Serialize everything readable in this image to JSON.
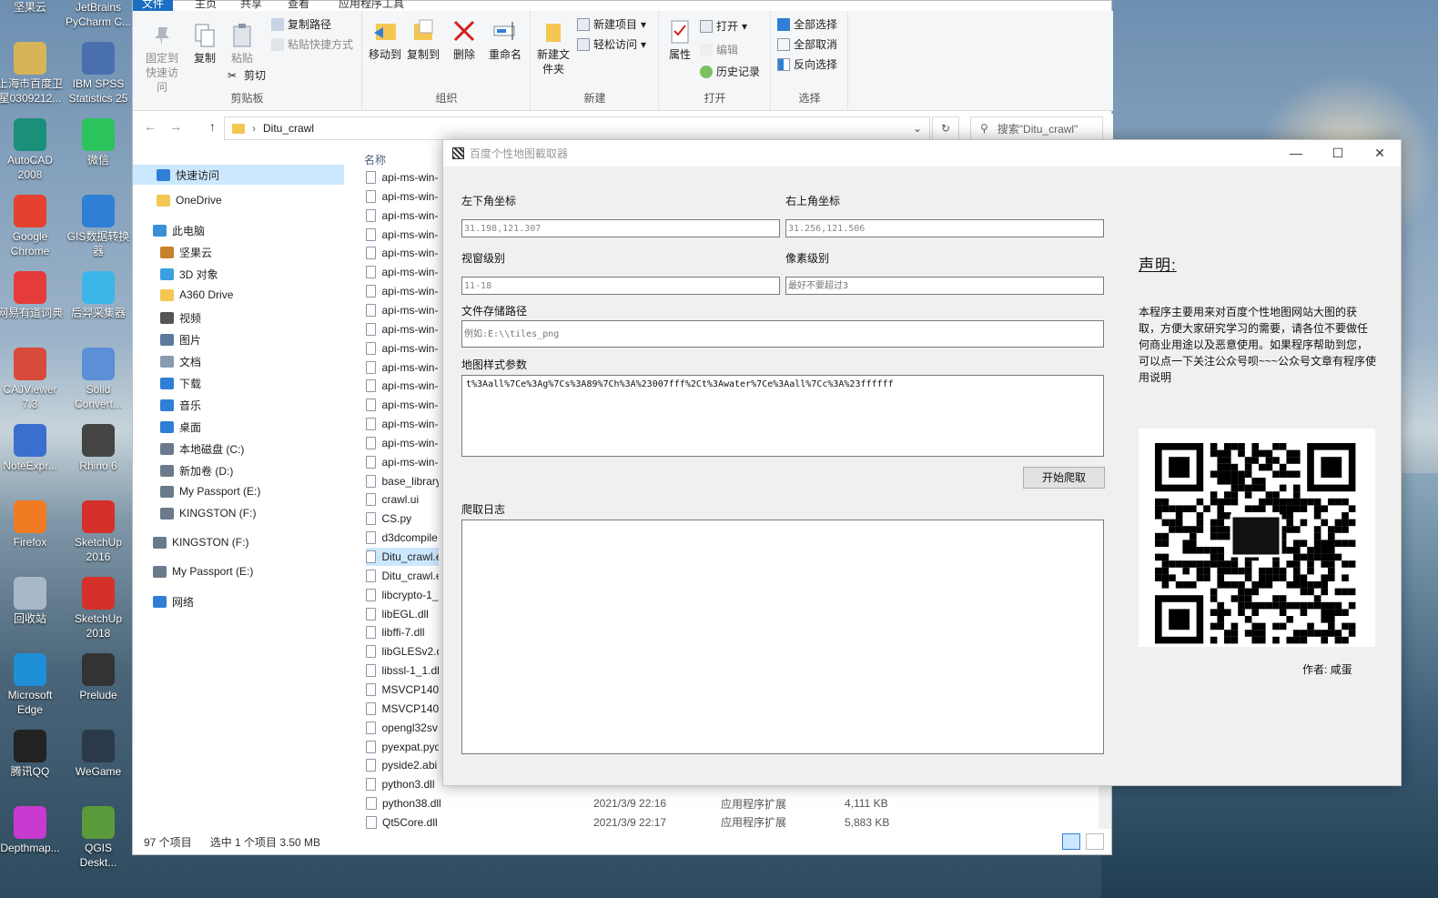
{
  "desktop": {
    "icons": [
      {
        "label": "坚果云",
        "icon": "jianguoyun-icon",
        "color": "#2f8fe0"
      },
      {
        "label": "JetBrains PyCharm C...",
        "icon": "pycharm-icon",
        "color": "#21d789"
      },
      {
        "label": "上海市百度卫星0309212...",
        "icon": "zip-icon",
        "color": "#d8b458"
      },
      {
        "label": "IBM SPSS Statistics 25",
        "icon": "spss-icon",
        "color": "#4a6fb0"
      },
      {
        "label": "AutoCAD 2008",
        "icon": "autocad-icon",
        "color": "#1a8f7a"
      },
      {
        "label": "微信",
        "icon": "wechat-icon",
        "color": "#2bc35c"
      },
      {
        "label": "Google Chrome",
        "icon": "chrome-icon",
        "color": "#e6412f"
      },
      {
        "label": "GIS数据转换器",
        "icon": "gis-icon",
        "color": "#2f7fd6"
      },
      {
        "label": "网易有道词典",
        "icon": "youdao-icon",
        "color": "#e53b3b"
      },
      {
        "label": "后羿采集器",
        "icon": "houyi-icon",
        "color": "#3cb6e8"
      },
      {
        "label": "CAJViewer 7.3",
        "icon": "cajviewer-icon",
        "color": "#d84a3a"
      },
      {
        "label": "Solid Convert...",
        "icon": "solid-icon",
        "color": "#5b8fd6"
      },
      {
        "label": "NoteExpr...",
        "icon": "noteexpress-icon",
        "color": "#3a6fd0"
      },
      {
        "label": "Rhino 6",
        "icon": "rhino-icon",
        "color": "#444444"
      },
      {
        "label": "Firefox",
        "icon": "firefox-icon",
        "color": "#f07b22"
      },
      {
        "label": "SketchUp 2016",
        "icon": "sketchup-icon",
        "color": "#d6302b"
      },
      {
        "label": "回收站",
        "icon": "recycle-bin-icon",
        "color": "#a9b8c8"
      },
      {
        "label": "SketchUp 2018",
        "icon": "sketchup-icon",
        "color": "#d6302b"
      },
      {
        "label": "Microsoft Edge",
        "icon": "edge-icon",
        "color": "#1f8fd8"
      },
      {
        "label": "Prelude",
        "icon": "prelude-icon",
        "color": "#333333"
      },
      {
        "label": "腾讯QQ",
        "icon": "qq-icon",
        "color": "#222222"
      },
      {
        "label": "WeGame",
        "icon": "wegame-icon",
        "color": "#2a3a4a"
      },
      {
        "label": "Depthmap...",
        "icon": "depthmap-icon",
        "color": "#c83ad0"
      },
      {
        "label": "QGIS Deskt...",
        "icon": "qgis-icon",
        "color": "#5a9a3a"
      }
    ]
  },
  "explorer": {
    "ribbon_tabs": [
      "文件",
      "主页",
      "共享",
      "查看",
      "应用程序工具"
    ],
    "clipboard": {
      "pin": "固定到快速访问",
      "copy": "复制",
      "paste": "粘贴",
      "copy_path": "复制路径",
      "paste_shortcut": "粘贴快捷方式",
      "cut": "剪切",
      "label": "剪贴板"
    },
    "organize": {
      "move_to": "移动到",
      "copy_to": "复制到",
      "delete": "删除",
      "rename": "重命名",
      "label": "组织"
    },
    "new": {
      "new_folder": "新建文件夹",
      "new_item": "新建项目",
      "easy_access": "轻松访问",
      "label": "新建"
    },
    "open": {
      "properties": "属性",
      "open": "打开",
      "edit": "编辑",
      "history": "历史记录",
      "label": "打开"
    },
    "select": {
      "select_all": "全部选择",
      "select_none": "全部取消",
      "invert": "反向选择",
      "label": "选择"
    },
    "address": {
      "path": "Ditu_crawl",
      "search_placeholder": "搜索\"Ditu_crawl\""
    },
    "nav": [
      {
        "label": "快速访问",
        "icon": "star-icon",
        "color": "#2f7fd6"
      },
      {
        "label": "OneDrive",
        "icon": "onedrive-icon",
        "color": "#f4c752"
      },
      {
        "label": "此电脑",
        "icon": "pc-icon",
        "color": "#3a8fd8"
      },
      {
        "label": "坚果云",
        "icon": "jianguoyun-icon",
        "color": "#c8822a"
      },
      {
        "label": "3D 对象",
        "icon": "cube-icon",
        "color": "#3aa0e0"
      },
      {
        "label": "A360 Drive",
        "icon": "folder-icon",
        "color": "#f4c752"
      },
      {
        "label": "视频",
        "icon": "video-icon",
        "color": "#555555"
      },
      {
        "label": "图片",
        "icon": "picture-icon",
        "color": "#5a7aa0"
      },
      {
        "label": "文档",
        "icon": "document-icon",
        "color": "#8a9ab0"
      },
      {
        "label": "下载",
        "icon": "download-icon",
        "color": "#2f7fd6"
      },
      {
        "label": "音乐",
        "icon": "music-icon",
        "color": "#2f7fd6"
      },
      {
        "label": "桌面",
        "icon": "desktop-icon",
        "color": "#2f7fd6"
      },
      {
        "label": "本地磁盘 (C:)",
        "icon": "drive-icon",
        "color": "#6a7a8a"
      },
      {
        "label": "新加卷 (D:)",
        "icon": "drive-icon",
        "color": "#6a7a8a"
      },
      {
        "label": "My Passport (E:)",
        "icon": "drive-icon",
        "color": "#6a7a8a"
      },
      {
        "label": "KINGSTON (F:)",
        "icon": "drive-icon",
        "color": "#6a7a8a"
      },
      {
        "label": "KINGSTON (F:)",
        "icon": "drive-icon",
        "color": "#6a7a8a"
      },
      {
        "label": "My Passport (E:)",
        "icon": "drive-icon",
        "color": "#6a7a8a"
      },
      {
        "label": "网络",
        "icon": "network-icon",
        "color": "#2f7fd6"
      }
    ],
    "column_name": "名称",
    "files": [
      {
        "name": "api-ms-win-"
      },
      {
        "name": "api-ms-win-"
      },
      {
        "name": "api-ms-win-"
      },
      {
        "name": "api-ms-win-"
      },
      {
        "name": "api-ms-win-"
      },
      {
        "name": "api-ms-win-"
      },
      {
        "name": "api-ms-win-"
      },
      {
        "name": "api-ms-win-"
      },
      {
        "name": "api-ms-win-"
      },
      {
        "name": "api-ms-win-"
      },
      {
        "name": "api-ms-win-"
      },
      {
        "name": "api-ms-win-"
      },
      {
        "name": "api-ms-win-"
      },
      {
        "name": "api-ms-win-"
      },
      {
        "name": "api-ms-win-"
      },
      {
        "name": "api-ms-win-"
      },
      {
        "name": "base_library"
      },
      {
        "name": "crawl.ui"
      },
      {
        "name": "CS.py"
      },
      {
        "name": "d3dcompile"
      },
      {
        "name": "Ditu_crawl.e"
      },
      {
        "name": "Ditu_crawl.e"
      },
      {
        "name": "libcrypto-1_"
      },
      {
        "name": "libEGL.dll"
      },
      {
        "name": "libffi-7.dll"
      },
      {
        "name": "libGLESv2.d"
      },
      {
        "name": "libssl-1_1.dl"
      },
      {
        "name": "MSVCP140."
      },
      {
        "name": "MSVCP140_"
      },
      {
        "name": "opengl32sv"
      },
      {
        "name": "pyexpat.pyd"
      },
      {
        "name": "pyside2.abi"
      },
      {
        "name": "python3.dll"
      },
      {
        "name": "python38.dll",
        "date": "2021/3/9 22:16",
        "type": "应用程序扩展",
        "size": "4,111 KB"
      },
      {
        "name": "Qt5Core.dll",
        "date": "2021/3/9 22:17",
        "type": "应用程序扩展",
        "size": "5,883 KB"
      }
    ],
    "status": {
      "count": "97 个项目",
      "selected": "选中 1 个项目  3.50 MB"
    }
  },
  "app": {
    "title": "百度个性地图截取器",
    "lower_left_label": "左下角坐标",
    "lower_left_value": "31.198,121.307",
    "upper_right_label": "右上角坐标",
    "upper_right_value": "31.256,121.506",
    "zoom_label": "视窗级别",
    "zoom_value": "11-18",
    "pixel_label": "像素级别",
    "pixel_placeholder": "最好不要超过3",
    "path_label": "文件存储路径",
    "path_placeholder": "例如:E:\\\\tiles_png",
    "style_label": "地图样式参数",
    "style_value": "t%3Aall%7Ce%3Ag%7Cs%3A89%7Ch%3A%23007fff%2Ct%3Awater%7Ce%3Aall%7Cc%3A%23ffffff",
    "start_button": "开始爬取",
    "log_label": "爬取日志",
    "declaration_title": "声明:",
    "declaration_text": "本程序主要用来对百度个性地图网站大图的获取，方便大家研究学习的需要，请各位不要做任何商业用途以及恶意使用。如果程序帮助到您，可以点一下关注公众号呗~~~公众号文章有程序使用说明",
    "author": "作者: 咸蛋"
  }
}
